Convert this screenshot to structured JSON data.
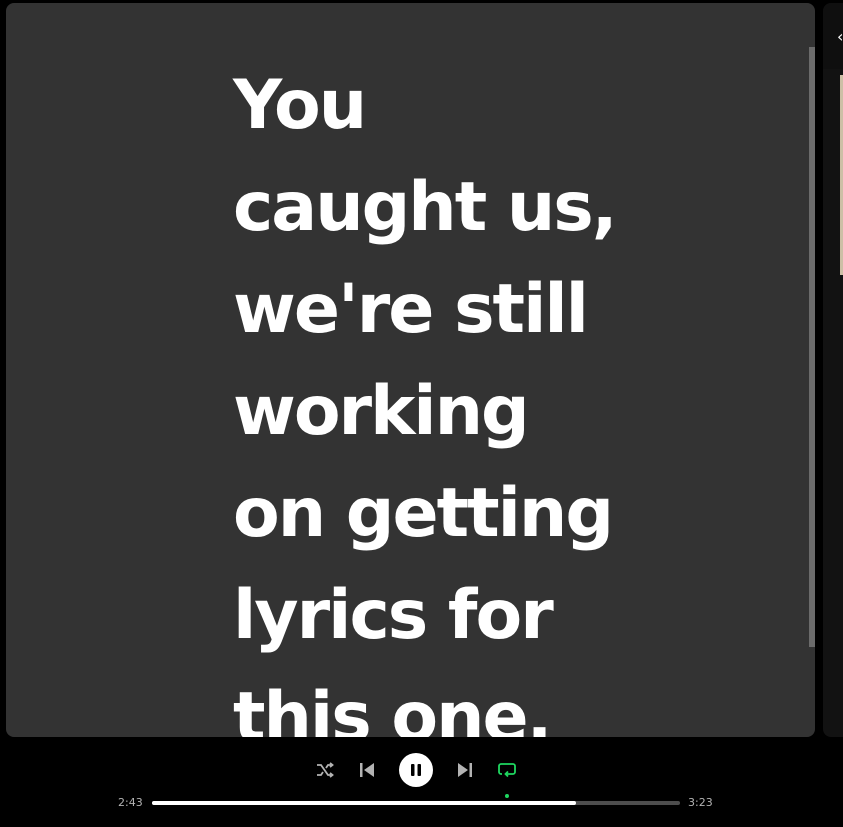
{
  "lyrics": {
    "message": "You\ncaught us,\nwe're still\nworking\non getting\nlyrics for\nthis one."
  },
  "side_panel": {
    "glyph": "‹"
  },
  "player": {
    "elapsed": "2:43",
    "total": "3:23",
    "progress_fraction": 0.803,
    "repeat_enabled": true,
    "is_playing": true,
    "icons": {
      "shuffle": "shuffle-icon",
      "previous": "skip-previous-icon",
      "play_pause": "pause-icon",
      "next": "skip-next-icon",
      "repeat": "repeat-icon"
    }
  },
  "colors": {
    "panel_background": "#333333",
    "lyrics_text": "#ffffff",
    "accent_green": "#1ed760",
    "player_background": "#000000",
    "muted_text": "#b3b3b3"
  }
}
